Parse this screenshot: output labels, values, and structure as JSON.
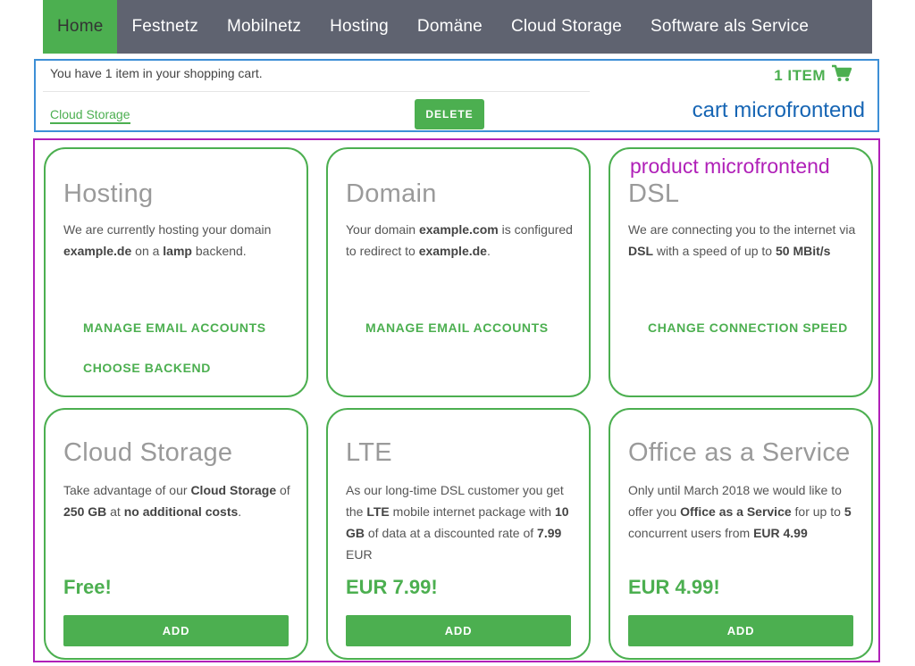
{
  "nav": {
    "items": [
      {
        "label": "Home",
        "active": true
      },
      {
        "label": "Festnetz"
      },
      {
        "label": "Mobilnetz"
      },
      {
        "label": "Hosting"
      },
      {
        "label": "Domäne"
      },
      {
        "label": "Cloud Storage"
      },
      {
        "label": "Software als Service"
      }
    ]
  },
  "cart": {
    "summary": "You have 1 item in your shopping cart.",
    "item_name": "Cloud Storage",
    "delete_label": "DELETE",
    "count_label": "1 ITEM",
    "icon": "shopping-cart-icon",
    "annotation": "cart microfrontend"
  },
  "products_annotation": "product microfrontend",
  "products": {
    "hosting": {
      "title": "Hosting",
      "desc": [
        "We are currently hosting your domain ",
        "example.de",
        " on a ",
        "lamp",
        " backend."
      ],
      "actions": [
        "MANAGE EMAIL ACCOUNTS",
        "CHOOSE BACKEND"
      ]
    },
    "domain": {
      "title": "Domain",
      "desc": [
        "Your domain ",
        "example.com",
        " is configured to redirect to ",
        "example.de",
        "."
      ],
      "actions": [
        "MANAGE EMAIL ACCOUNTS"
      ]
    },
    "dsl": {
      "title": "DSL",
      "desc": [
        "We are connecting you to the internet via ",
        "DSL",
        " with a speed of up to ",
        "50 MBit/s"
      ],
      "actions": [
        "CHANGE CONNECTION SPEED"
      ]
    },
    "cloud": {
      "title": "Cloud Storage",
      "desc": [
        "Take advantage of our ",
        "Cloud Storage",
        " of ",
        "250 GB",
        " at ",
        "no additional costs",
        "."
      ],
      "price": "Free!",
      "add_label": "ADD"
    },
    "lte": {
      "title": "LTE",
      "desc": [
        "As our long-time DSL customer you get the ",
        "LTE",
        " mobile internet package with ",
        "10 GB",
        " of data at a discounted rate of ",
        "7.99",
        " EUR"
      ],
      "price": "EUR 7.99!",
      "add_label": "ADD"
    },
    "office": {
      "title": "Office as a Service",
      "desc": [
        "Only until March 2018 we would like to offer you ",
        "Office as a Service",
        " for up to ",
        "5",
        " concurrent users from ",
        "EUR 4.99"
      ],
      "price": "EUR 4.99!",
      "add_label": "ADD"
    }
  },
  "colors": {
    "accent": "#4caf50",
    "nav_bg": "#5f6370",
    "cart_border": "#3d8fd6",
    "product_border": "#b020b8"
  }
}
